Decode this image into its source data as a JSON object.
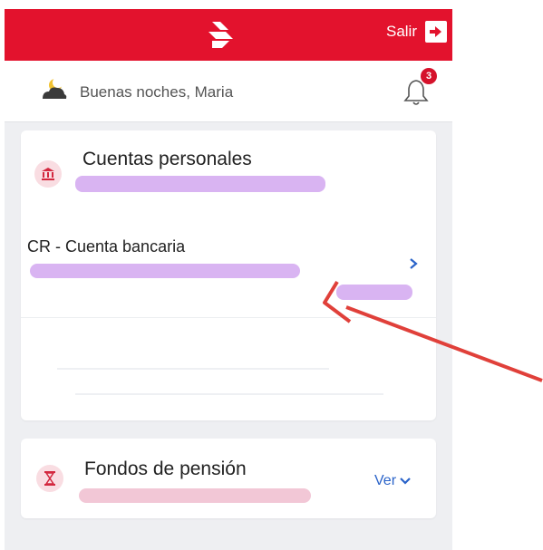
{
  "header": {
    "logout_label": "Salir"
  },
  "greeting": {
    "text": "Buenas noches, Maria",
    "notification_count": "3"
  },
  "personal_accounts": {
    "title": "Cuentas personales",
    "account_name": "CR - Cuenta bancaria"
  },
  "pension_funds": {
    "title": "Fondos de pensión",
    "toggle_label": "Ver"
  },
  "colors": {
    "brand_red": "#e3122d",
    "link_blue": "#2a63c9",
    "annotation_arrow": "#e0403a"
  }
}
